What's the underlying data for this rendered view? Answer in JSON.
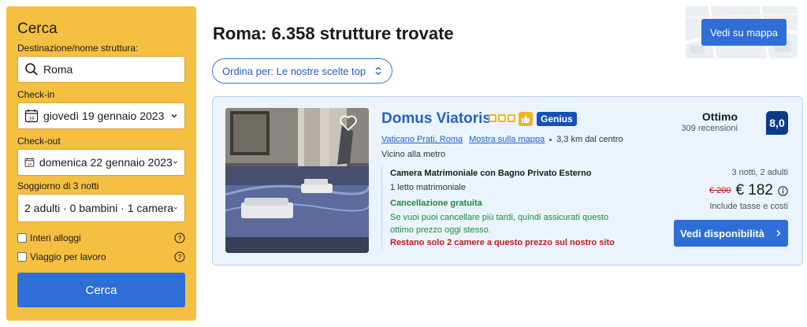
{
  "sidebar": {
    "title": "Cerca",
    "destination_label": "Destinazione/nome struttura:",
    "destination_value": "Roma",
    "checkin_label": "Check-in",
    "checkin_value": "giovedì 19 gennaio 2023",
    "checkin_day": "19",
    "checkout_label": "Check-out",
    "checkout_value": "domenica 22 gennaio 2023",
    "checkout_day": "22",
    "stay_label": "Soggiorno di 3 notti",
    "guests_value": "2 adulti · 0 bambini · 1 camera",
    "checkbox_entire": "Interi alloggi",
    "checkbox_work": "Viaggio per lavoro",
    "search_button": "Cerca"
  },
  "header": {
    "title": "Roma: 6.358 strutture trovate",
    "sort_label": "Ordina per: Le nostre scelte top",
    "map_button": "Vedi su mappa"
  },
  "property": {
    "name": "Domus Viatoris",
    "genius_badge": "Genius",
    "district_link": "Vaticano Prati, Roma",
    "map_link": "Mostra sulla mappa",
    "distance": "3,3 km dal centro",
    "near_metro": "Vicino alla metro",
    "room_name": "Camera Matrimoniale con Bagno Privato Esterno",
    "bed": "1 letto matrimoniale",
    "free_cancellation": "Cancellazione gratuita",
    "cancel_note": "Se vuoi puoi cancellare più tardi, quindi assicurati questo ottimo prezzo oggi stesso.",
    "scarcity": "Restano solo 2 camere a questo prezzo sul nostro sito",
    "rating_word": "Ottimo",
    "reviews": "309 recensioni",
    "score": "8,0",
    "stay_info": "3 notti, 2 adulti",
    "old_price": "€ 200",
    "new_price": "€ 182",
    "taxes": "Include tasse e costi",
    "availability_button": "Vedi disponibilità"
  },
  "colors": {
    "sidebar_bg": "#f5bf42",
    "primary_blue": "#2f6ed6",
    "score_navy": "#0d3b8a",
    "green": "#1f8a3b",
    "red": "#c11b1b"
  }
}
